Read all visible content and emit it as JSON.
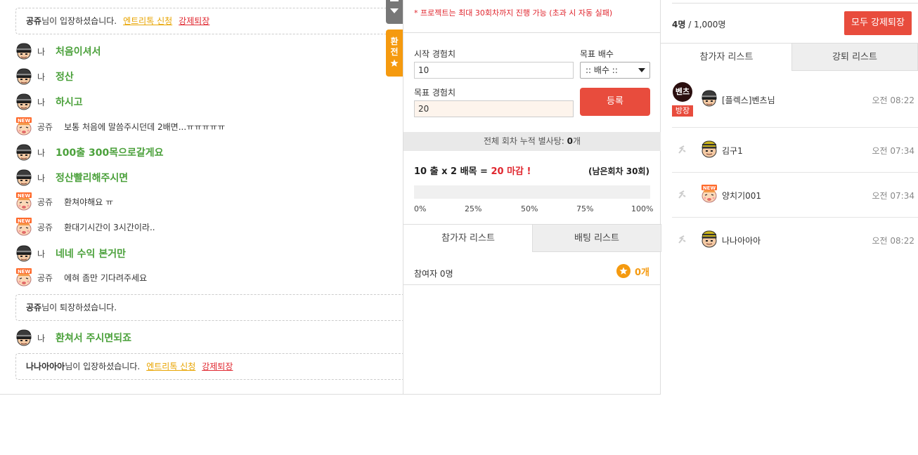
{
  "chat": {
    "sys1": {
      "user": "공쥬",
      "text": "님이 입장하셨습니다.",
      "act1": "엔트리톡 신청",
      "act2": "강제퇴장"
    },
    "messages": [
      {
        "type": "me",
        "nick": "나",
        "text": "처음이셔서",
        "avatar": "helmet-avatar-icon"
      },
      {
        "type": "me",
        "nick": "나",
        "text": "정산",
        "avatar": "helmet-avatar-icon"
      },
      {
        "type": "me",
        "nick": "나",
        "text": "하시고",
        "avatar": "helmet-avatar-icon"
      },
      {
        "type": "other",
        "nick": "공쥬",
        "text": "보통 처음에 말씀주시던데 2배면...ㅠㅠㅠㅠㅠ",
        "avatar": "new-user-avatar-icon"
      },
      {
        "type": "me",
        "nick": "나",
        "text": "100출 300목으로갈게요",
        "avatar": "helmet-avatar-icon"
      },
      {
        "type": "me",
        "nick": "나",
        "text": "정산빨리해주시면",
        "avatar": "helmet-avatar-icon"
      },
      {
        "type": "other",
        "nick": "공쥬",
        "text": "환쳐야해요 ㅠ",
        "avatar": "new-user-avatar-icon"
      },
      {
        "type": "other",
        "nick": "공쥬",
        "text": "환대기시간이 3시간이라..",
        "avatar": "new-user-avatar-icon"
      },
      {
        "type": "me",
        "nick": "나",
        "text": "네네 수익 본거만",
        "avatar": "helmet-avatar-icon"
      },
      {
        "type": "other",
        "nick": "공쥬",
        "text": "에혀 좀만 기다려주세요",
        "avatar": "new-user-avatar-icon"
      }
    ],
    "sys2": {
      "user": "공쥬",
      "text": "님이 퇴장하셨습니다."
    },
    "msg_last": {
      "type": "me",
      "nick": "나",
      "text": "환쳐서 주시면되죠"
    },
    "sys3": {
      "user": "나나아아아",
      "text": "님이 입장하셨습니다.",
      "act1": "엔트리톡 신청",
      "act2": "강제퇴장"
    },
    "orange_tab": {
      "line1": "환",
      "line2": "전"
    }
  },
  "project": {
    "notice": "* 프로젝트는 최대 30회차까지 진행 가능 (초과 시 자동 실패)",
    "start_label": "시작 경험치",
    "start_value": "10",
    "multiplier_label": "목표 배수",
    "multiplier_value": ":: 배수 ::",
    "target_label": "목표 경험치",
    "target_value": "20",
    "register_button": "등록",
    "cumulative_prefix": "전체 회차 누적 별사탕: ",
    "cumulative_value": "0",
    "cumulative_suffix": "개",
    "formula_left": "10 출 x 2 배목 = ",
    "formula_right": "20 마감 !",
    "remaining": "(남은회차 30회)",
    "progress": 0,
    "pct_labels": [
      "0%",
      "25%",
      "50%",
      "75%",
      "100%"
    ],
    "tabs": [
      "참가자 리스트",
      "배팅 리스트"
    ],
    "participants_label": "참여자 0명",
    "star_count": "0개"
  },
  "room": {
    "count_current": "4명",
    "count_sep": " / ",
    "count_max": "1,000명",
    "kick_all_button": "모두 강제퇴장",
    "tabs": [
      "참가자 리스트",
      "강퇴 리스트"
    ],
    "users": [
      {
        "name": "[플렉스]벤츠님",
        "time": "오전 08:22",
        "host_badge": "방장",
        "host_icon_text": "벤츠",
        "avatar": "helmet-avatar-icon"
      },
      {
        "name": "김구1",
        "time": "오전 07:34",
        "avatar": "striped-hat-avatar-icon"
      },
      {
        "name": "양치기001",
        "time": "오전 07:34",
        "avatar": "new-user-avatar-icon"
      },
      {
        "name": "나나아아아",
        "time": "오전 08:22",
        "avatar": "striped-hat-avatar-icon"
      }
    ]
  }
}
